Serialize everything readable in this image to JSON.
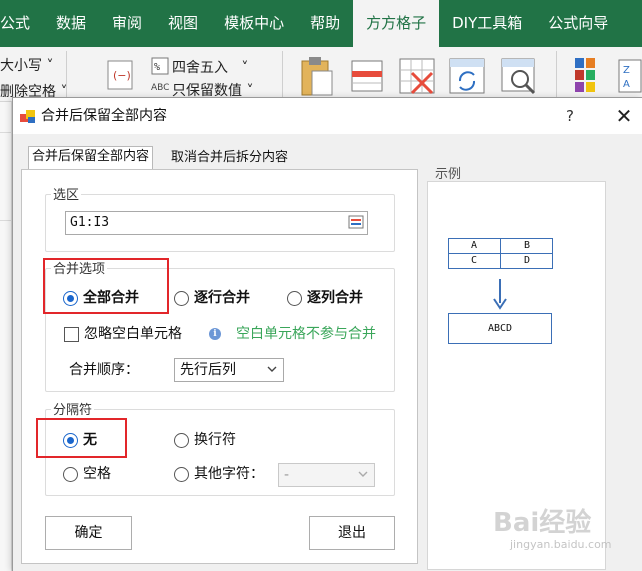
{
  "ribbon_tabs": [
    "公式",
    "数据",
    "审阅",
    "视图",
    "模板中心",
    "帮助",
    "方方格子",
    "DIY工具箱",
    "公式向导"
  ],
  "ribbon_active_tab": "方方格子",
  "ribbon_items": {
    "case_label": "大小写",
    "delete_spaces_label": "删除空格",
    "round_label": "四舍五入",
    "keep_values_label": "只保留数值"
  },
  "dialog": {
    "title": "合并后保留全部内容",
    "help": "?",
    "close": "✕",
    "tabs": [
      "合并后保留全部内容",
      "取消合并后拆分内容"
    ],
    "range_group_title": "选区",
    "range_value": "G1:I3",
    "merge_group_title": "合并选项",
    "merge_options": [
      "全部合并",
      "逐行合并",
      "逐列合并"
    ],
    "merge_selected": "全部合并",
    "ignore_blank_label": "忽略空白单元格",
    "ignore_blank_checked": false,
    "hint_text": "空白单元格不参与合并",
    "order_label": "合并顺序：",
    "order_value": "先行后列",
    "separator_group_title": "分隔符",
    "sep_none": "无",
    "sep_newline": "换行符",
    "sep_space": "空格",
    "sep_other": "其他字符：",
    "sep_other_value": "-",
    "sep_selected": "无",
    "ok_label": "确定",
    "exit_label": "退出",
    "example_title": "示例",
    "example_grid": [
      [
        "A",
        "B"
      ],
      [
        "C",
        "D"
      ]
    ],
    "example_result": "ABCD"
  },
  "colors": {
    "excel_green": "#217346",
    "highlight_red": "#e2262a",
    "hint_green": "#3aa65a",
    "radio_blue": "#1a66cc",
    "arrow_blue": "#3b6fb6"
  },
  "watermark": {
    "main": "Bai经验",
    "sub": "jingyan.baidu.com"
  }
}
